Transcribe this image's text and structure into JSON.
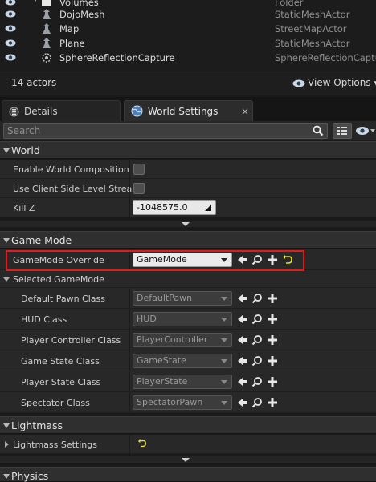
{
  "outliner": {
    "rows": [
      {
        "name": "Volumes",
        "type": "Folder"
      },
      {
        "name": "DojoMesh",
        "type": "StaticMeshActor"
      },
      {
        "name": "Map",
        "type": "StreetMapActor"
      },
      {
        "name": "Plane",
        "type": "StaticMeshActor"
      },
      {
        "name": "SphereReflectionCapture",
        "type": "SphereReflectionCapture"
      }
    ],
    "actor_count": "14 actors",
    "view_options": "View Options"
  },
  "tabs": {
    "details": "Details",
    "world_settings": "World Settings"
  },
  "search": {
    "placeholder": "Search"
  },
  "sections": {
    "world": "World",
    "game_mode": "Game Mode",
    "lightmass": "Lightmass",
    "physics": "Physics"
  },
  "world": {
    "enable_world_composition": "Enable World Composition",
    "use_client_side_level_stream": "Use Client Side Level Stream",
    "kill_z_label": "Kill Z",
    "kill_z_value": "-1048575.0"
  },
  "game_mode": {
    "override_label": "GameMode Override",
    "override_value": "GameMode",
    "selected_label": "Selected GameMode",
    "classes": [
      {
        "label": "Default Pawn Class",
        "value": "DefaultPawn"
      },
      {
        "label": "HUD Class",
        "value": "HUD"
      },
      {
        "label": "Player Controller Class",
        "value": "PlayerController"
      },
      {
        "label": "Game State Class",
        "value": "GameState"
      },
      {
        "label": "Player State Class",
        "value": "PlayerState"
      },
      {
        "label": "Spectator Class",
        "value": "SpectatorPawn"
      }
    ]
  },
  "lightmass": {
    "settings_label": "Lightmass Settings"
  },
  "colors": {
    "highlight": "#e21a1a",
    "reset_arrow": "#e8e030"
  }
}
